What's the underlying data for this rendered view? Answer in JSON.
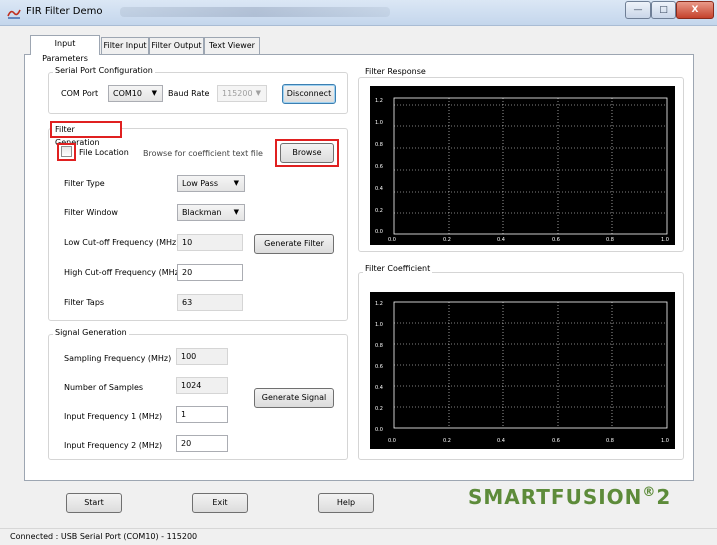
{
  "window": {
    "title": "FIR Filter Demo",
    "minimize": "—",
    "maximize": "□",
    "close": "X"
  },
  "tabs": [
    {
      "label": "Input Parameters"
    },
    {
      "label": "Filter Input"
    },
    {
      "label": "Filter Output"
    },
    {
      "label": "Text Viewer"
    }
  ],
  "serial": {
    "group_label": "Serial Port Configuration",
    "com_label": "COM Port",
    "com_value": "COM10",
    "baud_label": "Baud Rate",
    "baud_value": "115200",
    "disconnect": "Disconnect"
  },
  "filter_gen": {
    "group_label": "Filter Generation",
    "file_location_label": "File Location",
    "file_placeholder": "Browse for coefficient text file",
    "browse": "Browse",
    "type_label": "Filter Type",
    "type_value": "Low Pass",
    "window_label": "Filter Window",
    "window_value": "Blackman",
    "low_cut_label": "Low Cut-off Frequency (MHz)",
    "low_cut_value": "10",
    "high_cut_label": "High Cut-off Frequency (MHz)",
    "high_cut_value": "20",
    "taps_label": "Filter Taps",
    "taps_value": "63",
    "generate_filter": "Generate Filter"
  },
  "signal_gen": {
    "group_label": "Signal Generation",
    "sampling_label": "Sampling Frequency (MHz)",
    "sampling_value": "100",
    "samples_label": "Number of Samples",
    "samples_value": "1024",
    "freq1_label": "Input Frequency 1 (MHz)",
    "freq1_value": "1",
    "freq2_label": "Input Frequency 2 (MHz)",
    "freq2_value": "20",
    "generate_signal": "Generate Signal"
  },
  "filter_response": {
    "title": "Filter Response",
    "y_ticks": [
      "1.2",
      "1.0",
      "0.8",
      "0.6",
      "0.4",
      "0.2",
      "0.0"
    ],
    "x_ticks": [
      "0.0",
      "0.2",
      "0.4",
      "0.6",
      "0.8",
      "1.0"
    ]
  },
  "filter_coefficient": {
    "title": "Filter Coefficient",
    "y_ticks": [
      "1.2",
      "1.0",
      "0.8",
      "0.6",
      "0.4",
      "0.2",
      "0.0"
    ],
    "x_ticks": [
      "0.0",
      "0.2",
      "0.4",
      "0.6",
      "0.8",
      "1.0"
    ]
  },
  "bottom": {
    "start": "Start",
    "exit": "Exit",
    "help": "Help"
  },
  "brand": {
    "text": "SMARTFUSION",
    "version": "2",
    "color": "#5d8b3a"
  },
  "status": "Connected : USB Serial Port (COM10) - 115200"
}
